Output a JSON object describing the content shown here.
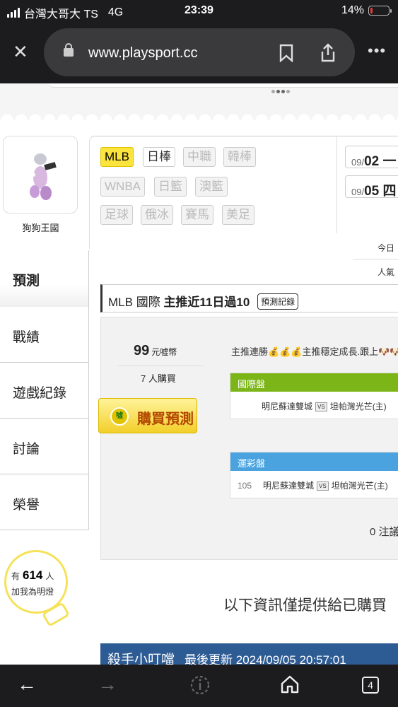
{
  "status": {
    "carrier": "台灣大哥大 TS",
    "network": "4G",
    "time": "23:39",
    "battery": "14%",
    "battery_level": 0.14,
    "battery_color": "#e53935"
  },
  "browser": {
    "url": "www.playsport.cc"
  },
  "profile": {
    "name": "狗狗王國"
  },
  "nav": [
    {
      "label": "預測"
    },
    {
      "label": "戰績"
    },
    {
      "label": "遊戲紀錄"
    },
    {
      "label": "討論"
    },
    {
      "label": "榮譽"
    }
  ],
  "fans": {
    "prefix": "有",
    "count": "614",
    "suffix": "人",
    "caption": "加我為明燈"
  },
  "leagues": [
    "MLB",
    "日棒",
    "中職",
    "韓棒",
    "WNBA",
    "日籃",
    "澳籃",
    "足球",
    "俄冰",
    "賽馬",
    "美足"
  ],
  "dates": [
    {
      "month": "09/",
      "day": "02",
      "rest": " 一"
    },
    {
      "month": "09/",
      "day": "05",
      "rest": " 四"
    }
  ],
  "side_labels": {
    "today": "今日",
    "popular": "人氣"
  },
  "prediction": {
    "league": "MLB",
    "type": "國際",
    "headline": "主推近11日過10",
    "record_button": "預測記錄",
    "price": "99",
    "price_unit": "元噓幣",
    "buyers": "7 人購買",
    "buy_button": "購買預測",
    "coin_label": "噓",
    "comment": "主推連勝💰💰💰主推穩定成長.跟上🐶🐶",
    "markets": [
      {
        "title": "國際盤",
        "color": "#7cb518",
        "number": "",
        "home": "明尼蘇達雙城",
        "vs": "VS",
        "away": "坦帕灣光芒(主)"
      },
      {
        "title": "運彩盤",
        "color": "#4aa3df",
        "number": "105",
        "home": "明尼蘇達雙城",
        "vs": "VS",
        "away": "坦帕灣光芒(主)"
      }
    ],
    "notes": "0 注議"
  },
  "info_notice": "以下資訊僅提供給已購買",
  "banner": {
    "name": "殺手小叮噹",
    "updated": "最後更新 2024/09/05 20:57:01"
  },
  "toolbar": {
    "back": "←",
    "forward": "→",
    "tabs": "4"
  }
}
